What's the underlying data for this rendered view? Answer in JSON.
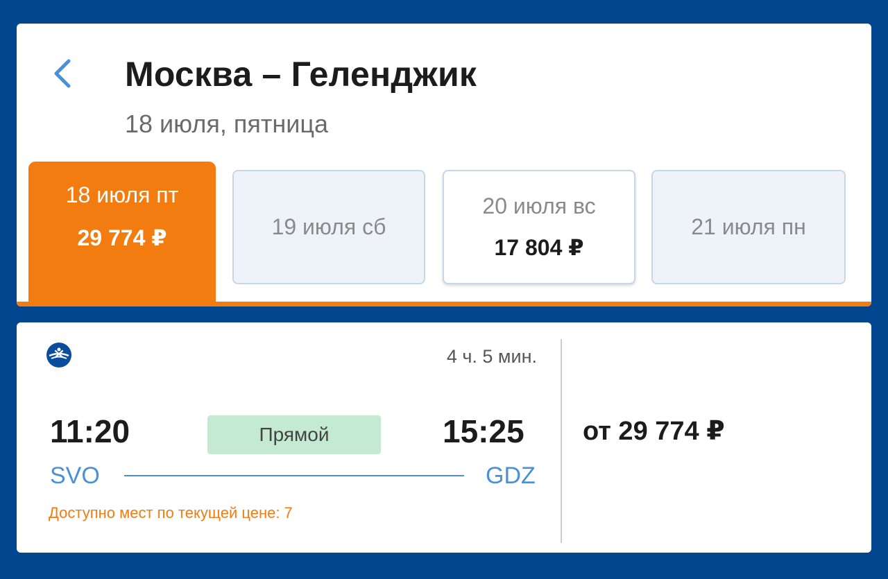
{
  "header": {
    "title": "Москва – Геленджик",
    "subtitle": "18 июля, пятница"
  },
  "date_tabs": [
    {
      "date": "18 июля пт",
      "price": "29 774 ₽",
      "state": "selected"
    },
    {
      "date": "19 июля сб",
      "price": "",
      "state": "no-price"
    },
    {
      "date": "20 июля вс",
      "price": "17 804 ₽",
      "state": "available"
    },
    {
      "date": "21 июля пн",
      "price": "",
      "state": "no-price"
    }
  ],
  "flight": {
    "airline_icon": "aeroflot-logo-icon",
    "duration": "4 ч. 5 мин.",
    "departure_time": "11:20",
    "arrival_time": "15:25",
    "departure_code": "SVO",
    "arrival_code": "GDZ",
    "direct_label": "Прямой",
    "seats_text": "Доступно мест по текущей цене: 7",
    "price": "от 29 774 ₽"
  },
  "colors": {
    "background": "#02468f",
    "accent_orange": "#f27c0f",
    "link_blue": "#4a90d9",
    "direct_badge": "#c5ead2"
  }
}
